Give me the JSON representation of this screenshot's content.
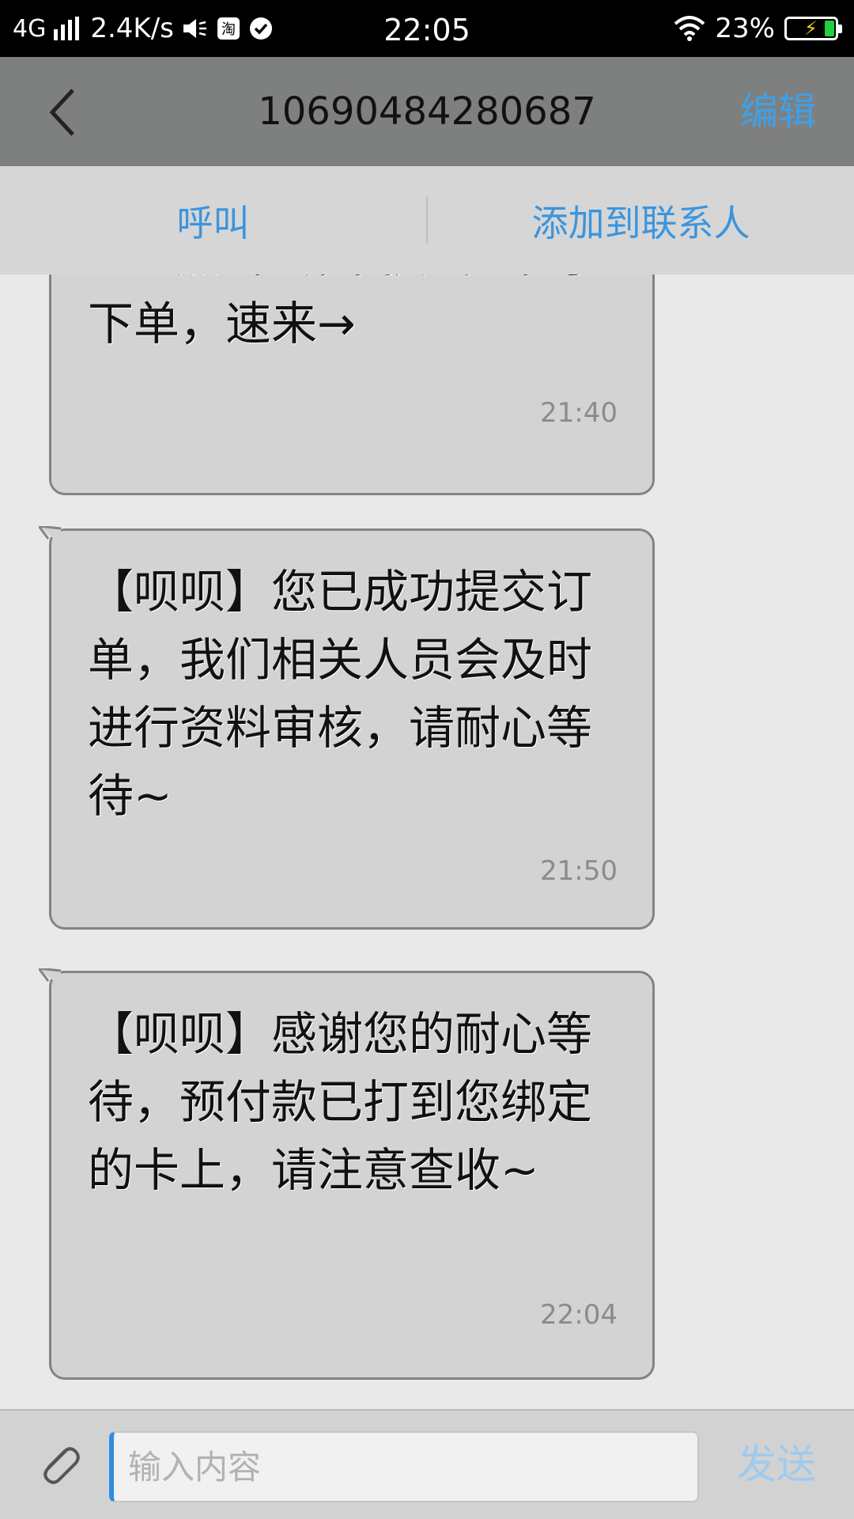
{
  "status_bar": {
    "network": "4G",
    "speed": "2.4K/s",
    "time": "22:05",
    "battery": "23%",
    "icons": [
      "signal-icon",
      "volume-icon",
      "taobao-icon",
      "check-icon",
      "wifi-icon",
      "battery-icon"
    ]
  },
  "header": {
    "title": "10690484280687",
    "edit_label": "编辑",
    "back_icon": "chevron-left-icon"
  },
  "actions": {
    "call_label": "呼叫",
    "add_contact_label": "添加到联系人"
  },
  "messages": [
    {
      "text": "APP点击“绑卡换钱”即可下单，速来→",
      "time": "21:40"
    },
    {
      "text": "【呗呗】您已成功提交订单，我们相关人员会及时进行资料审核，请耐心等待~",
      "time": "21:50"
    },
    {
      "text": "【呗呗】感谢您的耐心等待，预付款已打到您绑定的卡上，请注意查收~",
      "time": "22:04"
    }
  ],
  "composer": {
    "placeholder": "输入内容",
    "send_label": "发送",
    "attach_icon": "paperclip-icon"
  },
  "colors": {
    "accent": "#3fa0e8",
    "title_bar": "#7e807f",
    "bubble": "#d3d3d3"
  }
}
